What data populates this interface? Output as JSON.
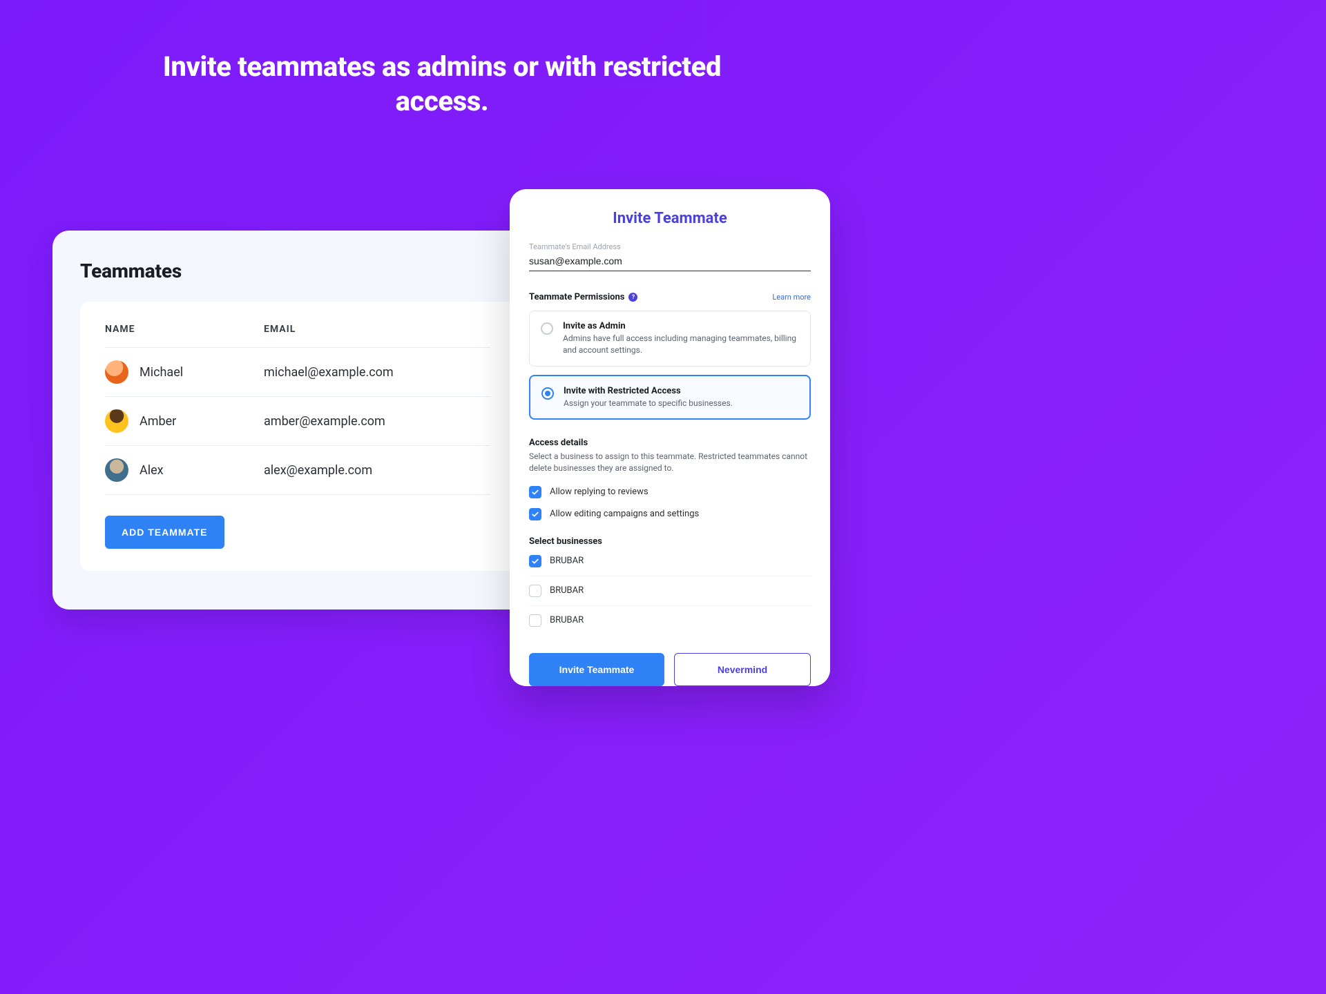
{
  "hero": {
    "title": "Invite teammates as admins or with restricted access."
  },
  "team_panel": {
    "heading": "Teammates",
    "columns": {
      "name": "NAME",
      "email": "EMAIL"
    },
    "rows": [
      {
        "name": "Michael",
        "email": "michael@example.com"
      },
      {
        "name": "Amber",
        "email": "amber@example.com"
      },
      {
        "name": "Alex",
        "email": "alex@example.com"
      }
    ],
    "add_button": "ADD TEAMMATE"
  },
  "invite_dialog": {
    "title": "Invite Teammate",
    "email_field": {
      "label": "Teammate's Email Address",
      "value": "susan@example.com"
    },
    "permissions": {
      "header_label": "Teammate Permissions",
      "learn_more": "Learn more",
      "options": [
        {
          "title": "Invite as Admin",
          "desc": "Admins have full access including managing teammates, billing and account settings.",
          "selected": false
        },
        {
          "title": "Invite with Restricted Access",
          "desc": "Assign your teammate to specific businesses.",
          "selected": true
        }
      ]
    },
    "access_details": {
      "heading": "Access details",
      "subtext": "Select a business to assign to this teammate. Restricted teammates cannot delete businesses they are assigned to.",
      "toggles": [
        {
          "label": "Allow replying to reviews",
          "checked": true
        },
        {
          "label": "Allow editing campaigns and settings",
          "checked": true
        }
      ]
    },
    "businesses": {
      "heading": "Select businesses",
      "items": [
        {
          "name": "BRUBAR",
          "checked": true
        },
        {
          "name": "BRUBAR",
          "checked": false
        },
        {
          "name": "BRUBAR",
          "checked": false
        }
      ]
    },
    "actions": {
      "primary": "Invite Teammate",
      "secondary": "Nevermind"
    }
  }
}
